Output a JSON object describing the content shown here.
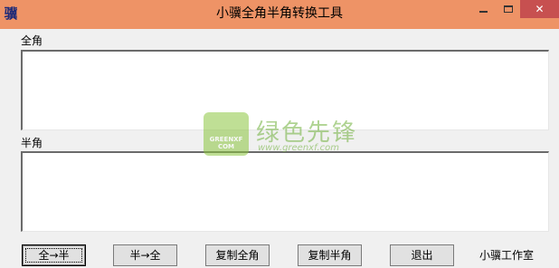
{
  "window": {
    "icon_glyph": "骥",
    "title": "小骥全角半角转换工具",
    "minimize_icon": "minimize-icon",
    "maximize_icon": "maximize-icon",
    "close_glyph": "✕",
    "titlebar_color": "#ee9366"
  },
  "fullwidth": {
    "label": "全角",
    "value": ""
  },
  "halfwidth": {
    "label": "半角",
    "value": ""
  },
  "buttons": {
    "to_half": "全→半",
    "to_full": "半→全",
    "copy_full": "复制全角",
    "copy_half": "复制半角",
    "exit": "退出"
  },
  "footer": {
    "studio": "小骥工作室"
  },
  "watermark": {
    "logo_text": "GREENXF COM",
    "brand": "绿色先锋",
    "url": "www.greenxf.com"
  }
}
